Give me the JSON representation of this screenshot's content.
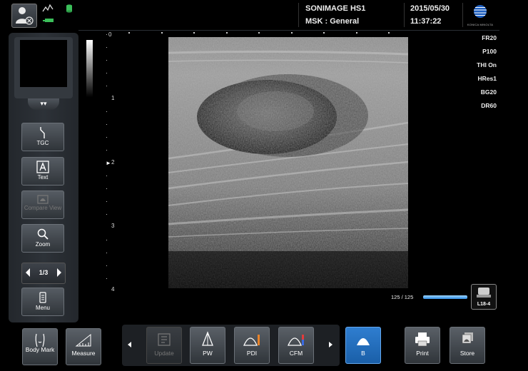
{
  "header": {
    "system_name": "SONIMAGE HS1",
    "preset": "MSK : General",
    "date": "2015/05/30",
    "time": "11:37:22",
    "logo_text": "KONICA MINOLTA",
    "logo_color": "#1f5fbf"
  },
  "left_panel": {
    "buttons": [
      {
        "label": "TGC",
        "icon": "tgc-curve-icon"
      },
      {
        "label": "Text",
        "icon": "text-a-icon"
      },
      {
        "label": "Compare View",
        "icon": "compare-view-icon",
        "disabled": true
      },
      {
        "label": "Zoom",
        "icon": "magnifier-icon"
      },
      {
        "label": "Menu",
        "icon": "menu-icon"
      }
    ],
    "page_indicator": "1/3"
  },
  "image": {
    "depth_ticks": [
      "0",
      "1",
      "2",
      "3",
      "4"
    ],
    "focus_depth_marker": "►",
    "params": [
      "FR20",
      "P100",
      "THI On",
      "HRes1",
      "BG20",
      "DR60"
    ],
    "gain_readout": "125 / 125",
    "gain_fraction": 1.0,
    "gain_color": "#2e8ce6",
    "probe": "L18-4"
  },
  "toolbar": {
    "buttons": [
      {
        "label": "Body Mark",
        "icon": "body-mark-icon"
      },
      {
        "label": "Measure",
        "icon": "ruler-icon"
      },
      {
        "label": "Update",
        "icon": "update-icon",
        "disabled": true
      },
      {
        "label": "PW",
        "icon": "pw-doppler-icon"
      },
      {
        "label": "PDI",
        "icon": "pdi-icon"
      },
      {
        "label": "CFM",
        "icon": "cfm-icon"
      },
      {
        "label": "B",
        "icon": "b-mode-icon",
        "active": true
      },
      {
        "label": "Print",
        "icon": "printer-icon"
      },
      {
        "label": "Store",
        "icon": "store-icon"
      }
    ],
    "active_color": "#2f7ed0"
  }
}
